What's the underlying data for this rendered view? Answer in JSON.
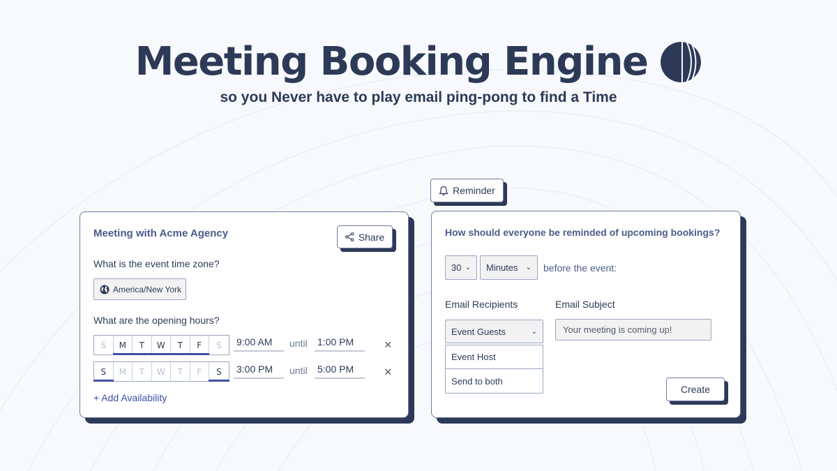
{
  "hero": {
    "title": "Meeting Booking Engine",
    "subtitle": "so you Never have to play email ping-pong to find a Time",
    "logo_icon": "striped-circle-logo"
  },
  "colors": {
    "navy": "#2d3a57",
    "accent_blue": "#3f4fa8",
    "muted_blue": "#4a5c8a",
    "background": "#f7f9fc",
    "input_bg": "#f2f2f2"
  },
  "availability_card": {
    "title": "Meeting with Acme Agency",
    "share_label": "Share",
    "share_icon": "share-icon",
    "timezone_question": "What is the event time zone?",
    "timezone_value": "America/New York",
    "timezone_icon": "globe-icon",
    "hours_question": "What are the opening hours?",
    "rows": [
      {
        "days": [
          {
            "label": "S",
            "active": false
          },
          {
            "label": "M",
            "active": true
          },
          {
            "label": "T",
            "active": true
          },
          {
            "label": "W",
            "active": true
          },
          {
            "label": "T",
            "active": true
          },
          {
            "label": "F",
            "active": true
          },
          {
            "label": "S",
            "active": false
          }
        ],
        "start": "9:00 AM",
        "until": "until",
        "end": "1:00 PM",
        "remove": "×"
      },
      {
        "days": [
          {
            "label": "S",
            "active": true
          },
          {
            "label": "M",
            "active": false
          },
          {
            "label": "T",
            "active": false
          },
          {
            "label": "W",
            "active": false
          },
          {
            "label": "T",
            "active": false
          },
          {
            "label": "F",
            "active": false
          },
          {
            "label": "S",
            "active": true
          }
        ],
        "start": "3:00 PM",
        "until": "until",
        "end": "5:00 PM",
        "remove": "×"
      }
    ],
    "add_availability": "+ Add Availability"
  },
  "reminder_tab": {
    "label": "Reminder",
    "icon": "bell-icon"
  },
  "reminder_card": {
    "question": "How should everyone be reminded of upcoming bookings?",
    "amount_value": "30",
    "unit_value": "Minutes",
    "before_text": "before the event:",
    "recipients_label": "Email Recipients",
    "recipients_selected": "Event Guests",
    "recipients_options": [
      "Event Host",
      "Send to both"
    ],
    "subject_label": "Email Subject",
    "subject_value": "Your meeting is coming up!",
    "create_label": "Create"
  }
}
